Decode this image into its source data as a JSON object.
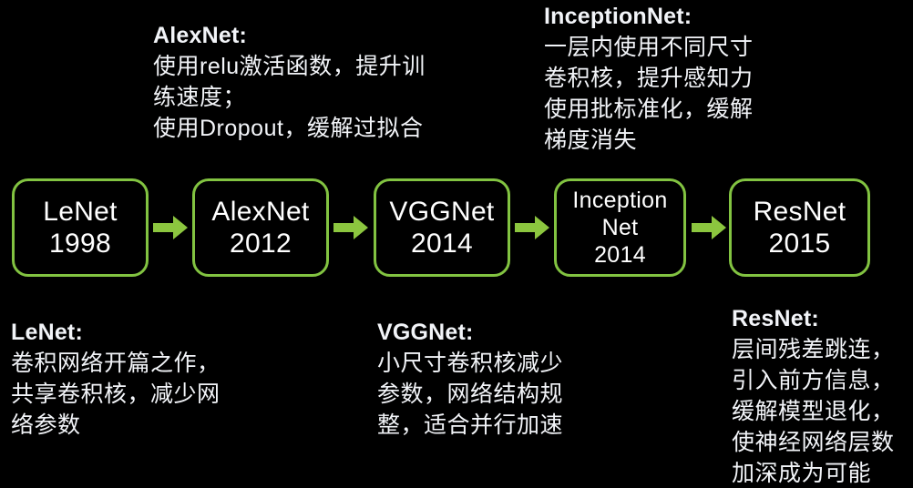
{
  "theme": {
    "background": "#000000",
    "text_color": "#ffffff",
    "accent_green": "#82c341",
    "arrow_green": "#8cc63f"
  },
  "flow": {
    "boxes": [
      {
        "name": "LeNet",
        "lines": [
          "LeNet",
          "1998"
        ],
        "compact": false
      },
      {
        "name": "AlexNet",
        "lines": [
          "AlexNet",
          "2012"
        ],
        "compact": false
      },
      {
        "name": "VGGNet",
        "lines": [
          "VGGNet",
          "2014"
        ],
        "compact": false
      },
      {
        "name": "InceptionNet",
        "lines": [
          "Inception",
          "Net",
          "2014"
        ],
        "compact": true
      },
      {
        "name": "ResNet",
        "lines": [
          "ResNet",
          "2015"
        ],
        "compact": false
      }
    ],
    "arrow_count": 4,
    "arrow_glyph": "right-arrow"
  },
  "notes": {
    "alexnet": {
      "title": "AlexNet:",
      "lines": [
        "使用relu激活函数，提升训",
        "练速度；",
        "使用Dropout，缓解过拟合"
      ]
    },
    "inception": {
      "title": "InceptionNet:",
      "lines": [
        "一层内使用不同尺寸",
        "卷积核，提升感知力",
        "使用批标准化，缓解",
        "梯度消失"
      ]
    },
    "lenet": {
      "title": "LeNet:",
      "lines": [
        "卷积网络开篇之作，",
        "共享卷积核，减少网",
        "络参数"
      ]
    },
    "vggnet": {
      "title": "VGGNet:",
      "lines": [
        "小尺寸卷积核减少",
        "参数，网络结构规",
        "整，适合并行加速"
      ]
    },
    "resnet": {
      "title": "ResNet:",
      "lines": [
        "层间残差跳连，",
        "引入前方信息，",
        "缓解模型退化，",
        "使神经网络层数",
        "加深成为可能"
      ]
    }
  }
}
